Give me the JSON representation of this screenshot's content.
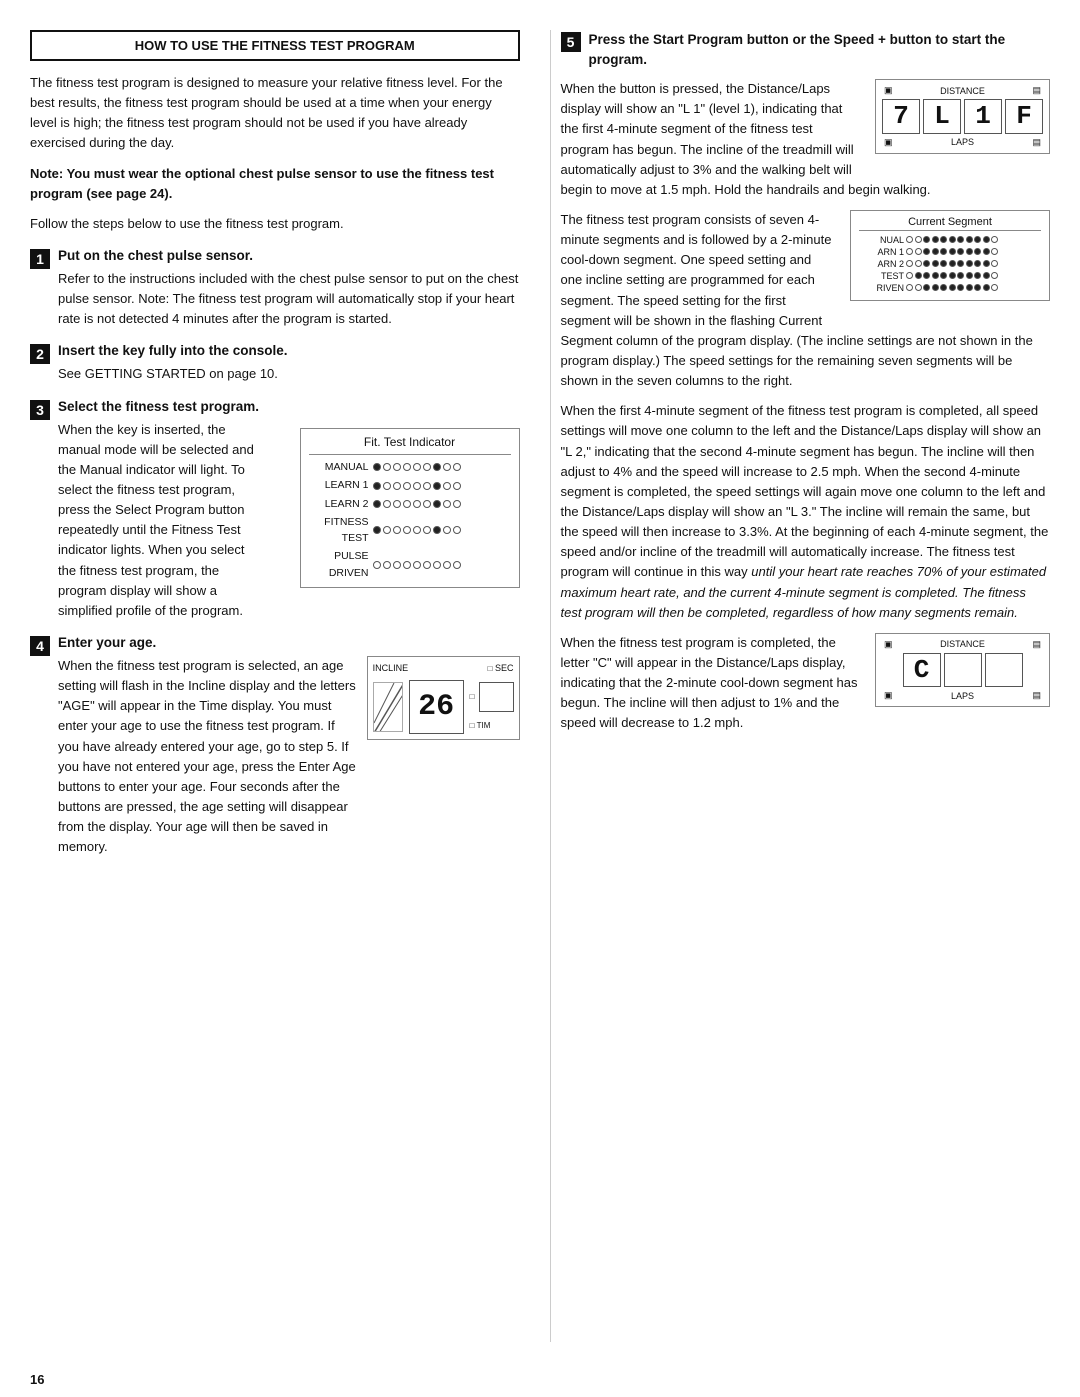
{
  "page": {
    "number": "16"
  },
  "left_col": {
    "section_header": "HOW TO USE THE FITNESS TEST PROGRAM",
    "intro_text": "The fitness test program is designed to measure your relative fitness level. For the best results, the fitness test program should be used at a time when your energy level is high; the fitness test program should not be used if you have already exercised during the day.",
    "bold_note": "Note: You must wear the optional chest pulse sensor to use the fitness test program (see page 24).",
    "follow_text": "Follow the steps below to use the fitness test program.",
    "steps": [
      {
        "number": "1",
        "title": "Put on the chest pulse sensor.",
        "body": "Refer to the instructions included with the chest pulse sensor to put on the chest pulse sensor. Note: The fitness test program will automatically stop if your heart rate is not detected 4 minutes after the program is started."
      },
      {
        "number": "2",
        "title": "Insert the key fully into the console.",
        "body": "See GETTING STARTED on page 10."
      },
      {
        "number": "3",
        "title": "Select the fitness test program.",
        "body_part1": "When the key is inserted, the manual mode will be selected and the Manual indicator will light. To select the fitness test program, press the Select Program button repeatedly until the Fitness Test indicator lights. When you select the fitness test program, the program display will show a simplified profile of the program."
      },
      {
        "number": "4",
        "title": "Enter your age.",
        "body_part1": "When the fitness test program is selected, an age setting will flash in the Incline display and the letters \"AGE\" will appear in the Time display. You must enter your age to use the fitness test program. If you have already entered your age, go to step 5. If you have not entered your age, press the Enter Age buttons to enter your age. Four seconds after the buttons are pressed, the age setting will disappear from the display. Your age will then be saved in memory."
      }
    ],
    "fit_test_diagram": {
      "header": "Fit. Test Indicator",
      "rows": [
        {
          "label": "MANUAL",
          "dots": [
            1,
            0,
            0,
            0,
            0,
            0,
            1,
            0,
            0
          ]
        },
        {
          "label": "LEARN 1",
          "dots": [
            1,
            0,
            0,
            0,
            0,
            0,
            1,
            0,
            0
          ]
        },
        {
          "label": "LEARN 2",
          "dots": [
            1,
            0,
            0,
            0,
            0,
            0,
            1,
            0,
            0
          ]
        },
        {
          "label": "FITNESS TEST",
          "dots": [
            1,
            0,
            0,
            0,
            0,
            0,
            1,
            0,
            0
          ]
        },
        {
          "label": "PULSE DRIVEN",
          "dots": [
            0,
            0,
            0,
            0,
            0,
            0,
            0,
            0,
            0
          ]
        }
      ]
    },
    "age_diagram": {
      "top_labels": [
        "INCLINE",
        "SEC"
      ],
      "big_number": "26",
      "bottom_labels": [
        "TIM"
      ]
    }
  },
  "right_col": {
    "step5": {
      "number": "5",
      "title": "Press the Start Program button or the Speed + button to start the program.",
      "para1": "When the button is pressed, the Distance/Laps display will show an \"L 1\" (level 1), indicating that the first 4-minute segment of the fitness test program has begun. The incline of the treadmill will automatically adjust to 3% and the walking belt will begin to move at 1.5 mph. Hold the handrails and begin walking.",
      "dist_display": {
        "top_label": "DISTANCE",
        "chars": [
          "7",
          "L",
          "1",
          "F"
        ],
        "bottom_label": "LAPS"
      },
      "para2": "The fitness test program consists of seven 4-minute segments and is followed by a 2-minute cool-down segment. One speed setting and one incline setting are programmed for each segment. The speed setting for the first segment will be shown in the flashing Current Segment column of the program display. (The incline settings are not shown in the program display.) The speed settings for the remaining seven segments will be shown in the seven columns to the right.",
      "current_segment": {
        "header": "Current Segment",
        "rows": [
          {
            "label": "NUAL",
            "dots": [
              0,
              0,
              1,
              1,
              1,
              1,
              1,
              1,
              1,
              1,
              0
            ]
          },
          {
            "label": "ARN 1",
            "dots": [
              0,
              0,
              1,
              1,
              1,
              1,
              1,
              1,
              1,
              1,
              0
            ]
          },
          {
            "label": "ARN 2",
            "dots": [
              0,
              0,
              1,
              1,
              1,
              1,
              1,
              1,
              1,
              1,
              0
            ]
          },
          {
            "label": "TEST",
            "dots": [
              0,
              1,
              1,
              1,
              1,
              1,
              1,
              1,
              1,
              1,
              0
            ]
          },
          {
            "label": "RIVEN",
            "dots": [
              0,
              0,
              1,
              1,
              1,
              1,
              1,
              1,
              1,
              1,
              0
            ]
          }
        ]
      },
      "para3": "When the first 4-minute segment of the fitness test program is completed, all speed settings will move one column to the left and the Distance/Laps display will show an \"L 2,\" indicating that the second 4-minute segment has begun. The incline will then adjust to 4% and the speed will increase to 2.5 mph. When the second 4-minute segment is completed, the speed settings will again move one column to the left and the Distance/Laps display will show an \"L 3.\" The incline will remain the same, but the speed will then increase to 3.3%. At the beginning of each 4-minute segment, the speed and/or incline of the treadmill will automatically increase. The fitness test program will continue in this way ",
      "italic_part": "until your heart rate reaches 70% of your estimated maximum heart rate, and the current 4-minute segment is completed. The fitness test program will then be completed, regardless of how many segments remain.",
      "para4": "When the fitness test program is completed, the letter \"C\" will appear in the Distance/Laps display, indicating that the 2-minute cool-down segment has begun. The incline will then adjust to 1% and the speed will decrease to 1.2 mph.",
      "cooldown_display": {
        "top_label": "DISTANCE",
        "chars": [
          "C",
          "",
          ""
        ],
        "bottom_label": "LAPS"
      }
    }
  }
}
